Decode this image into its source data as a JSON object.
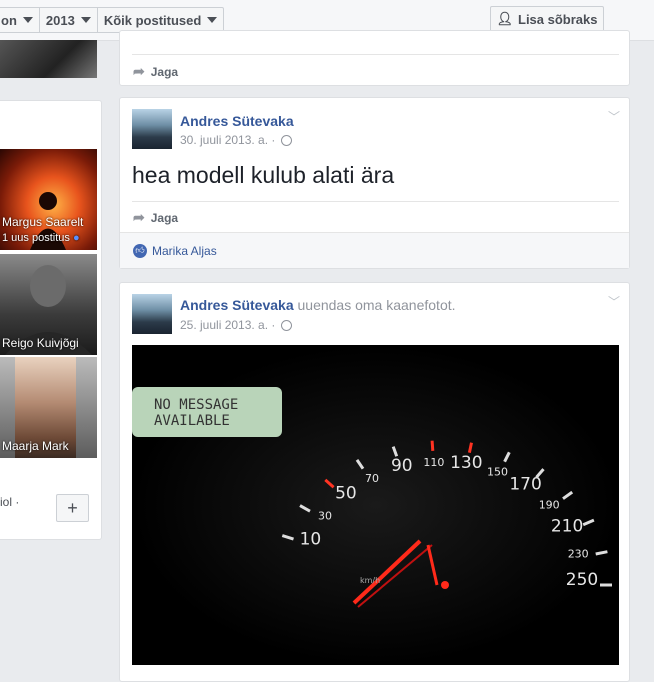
{
  "filters": {
    "month": "on",
    "year": "2013",
    "posts": "Kõik postitused"
  },
  "add_friend_label": "Lisa sõbraks",
  "friends": [
    {
      "name": "Margus Saarelt",
      "status": "1 uus postitus"
    },
    {
      "name": "Reigo Kuivjõgi"
    },
    {
      "name": "Maarja Mark"
    }
  ],
  "left_footer_text": "iol ·",
  "plus_label": "+",
  "share_label": "Jaga",
  "post1": {
    "author": "Andres Sütevaka",
    "date": "30. juuli 2013. a. ·",
    "text": "hea modell kulub alati ära",
    "liker": "Marika Aljas"
  },
  "post2": {
    "author": "Andres Sütevaka",
    "action": "uuendas oma kaanefotot.",
    "date": "25. juuli 2013. a. ·",
    "display_text": "NO MESSAGE AVAILABLE",
    "speed_labels": [
      "10",
      "30",
      "50",
      "70",
      "90",
      "110",
      "130",
      "150",
      "170",
      "190",
      "210",
      "230",
      "250"
    ],
    "unit": "km/h"
  }
}
